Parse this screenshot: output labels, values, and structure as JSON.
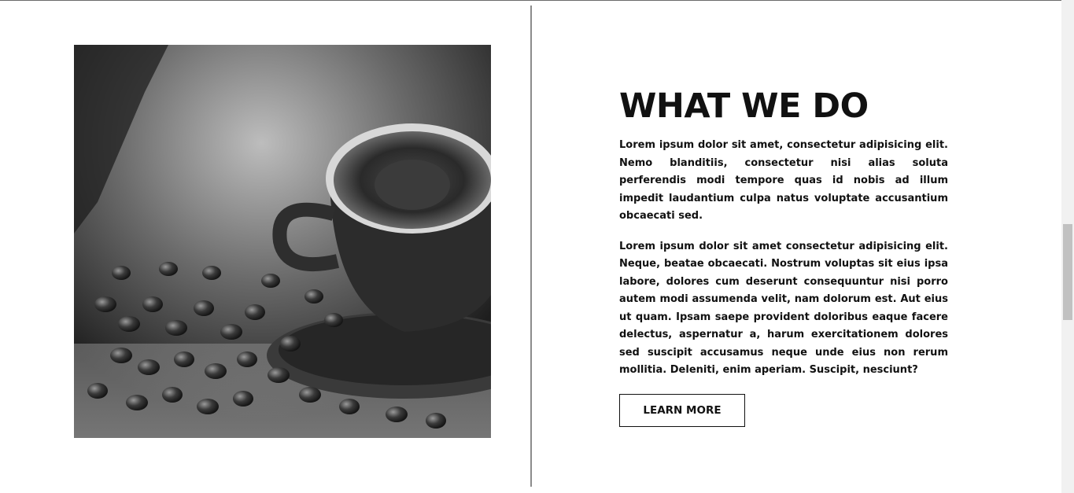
{
  "section": {
    "heading": "WHAT WE DO",
    "paragraphs": [
      "Lorem ipsum dolor sit amet, consectetur adipisicing elit. Nemo blanditiis, consectetur nisi alias soluta perferendis modi tempore quas id nobis ad illum impedit laudantium culpa natus voluptate accusantium obcaecati sed.",
      "Lorem ipsum dolor sit amet consectetur adipisicing elit. Neque, beatae obcaecati. Nostrum voluptas sit eius ipsa labore, dolores cum deserunt consequuntur nisi porro autem modi assumenda velit, nam dolorum est. Aut eius ut quam. Ipsam saepe provident doloribus eaque facere delectus, aspernatur a, harum exercitationem dolores sed suscipit accusamus neque unde eius non rerum mollitia. Deleniti, enim aperiam. Suscipit, nesciunt?"
    ],
    "button_label": "LEARN MORE"
  },
  "image": {
    "subject": "coffee cup with coffee beans (black and white photo)"
  },
  "colors": {
    "text": "#111111",
    "divider": "#8c8c8c",
    "background": "#ffffff"
  }
}
